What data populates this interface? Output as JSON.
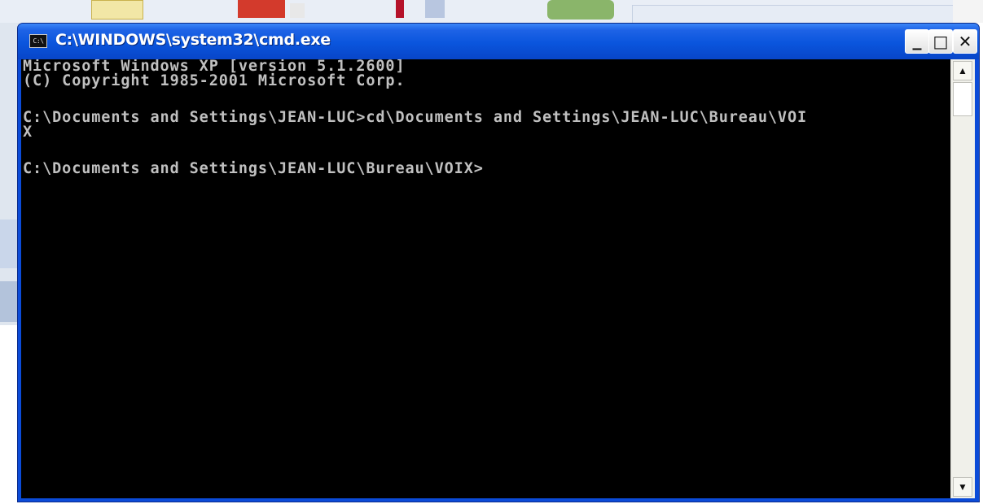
{
  "window": {
    "title": "C:\\WINDOWS\\system32\\cmd.exe",
    "icon": "cmd-window-icon",
    "icon_text": "C:\\",
    "controls": {
      "minimize": "_",
      "maximize": "□",
      "close": "✕"
    }
  },
  "console": {
    "lines": [
      "Microsoft Windows XP [version 5.1.2600]",
      "(C) Copyright 1985-2001 Microsoft Corp.",
      "",
      "C:\\Documents and Settings\\JEAN-LUC>cd\\Documents and Settings\\JEAN-LUC\\Bureau\\VOI",
      "X",
      "",
      "C:\\Documents and Settings\\JEAN-LUC\\Bureau\\VOIX>"
    ]
  },
  "scrollbar": {
    "up_arrow": "▲",
    "down_arrow": "▼"
  },
  "colors": {
    "titlebar": "#0a55dd",
    "console_bg": "#000000",
    "console_fg": "#c0c0c0"
  }
}
